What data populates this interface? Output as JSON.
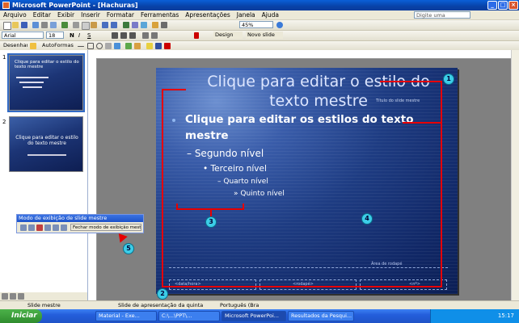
{
  "window": {
    "title": "Microsoft PowerPoint - [Hachuras]",
    "minimize": "_",
    "maximize": "□",
    "close": "×"
  },
  "menu": [
    "Arquivo",
    "Editar",
    "Exibir",
    "Inserir",
    "Formatar",
    "Ferramentas",
    "Apresentações",
    "Janela",
    "Ajuda"
  ],
  "help_box": "Digite uma pergunta",
  "toolbar": {
    "zoom": "45%",
    "font": "Arial",
    "font_size": "18",
    "design_button": "Design",
    "new_slide_button": "Novo slide",
    "draw_menu": "Desenhar",
    "autoshapes_menu": "AutoFormas"
  },
  "thumbnails": [
    {
      "number": "1",
      "title": "Clique para editar o estilo do texto mestre"
    },
    {
      "number": "2",
      "title": "Clique para editar o estilo do texto mestre"
    }
  ],
  "slide": {
    "title_line1": "Clique para editar o estilo do",
    "title_line2": "texto mestre",
    "subtitle": "Título do slide mestre",
    "level1_line1": "Clique para editar os estilos do texto",
    "level1_line2": "mestre",
    "level2": "– Segundo nível",
    "level3": "• Terceiro nível",
    "level4": "– Quarto nível",
    "level5": "» Quinto nível",
    "footer_title": "Área de rodapé",
    "footer_date": "<data/hora>",
    "footer_center": "<rodapé>",
    "footer_num": "<nº>"
  },
  "floatbar": {
    "title": "Modo de exibição de slide mestre",
    "close_button": "Fechar modo de exibição mestre"
  },
  "callouts": [
    "1",
    "2",
    "3",
    "4",
    "5"
  ],
  "status": {
    "left": "Slide mestre",
    "middle": "Slide de apresentação da quinta",
    "language": "Português (Bra"
  },
  "taskbar": {
    "start": "Iniciar",
    "items": [
      "Material - Exe...",
      "C:\\...\\PPT\\...",
      "Microsoft PowerPoi...",
      "Resultados da Pesqui..."
    ],
    "clock": "15:17"
  },
  "colors": {
    "annotation_red": "#E60000",
    "callout_cyan": "#3CCDE8",
    "slide_blue": "#1E3C82"
  }
}
